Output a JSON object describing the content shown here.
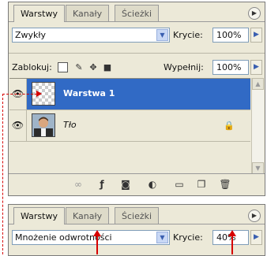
{
  "panel1": {
    "tabs": [
      "Warstwy",
      "Kanały",
      "Ścieżki"
    ],
    "blend_mode": "Zwykły",
    "opacity_label": "Krycie:",
    "opacity_value": "100%",
    "lock_label": "Zablokuj:",
    "fill_label": "Wypełnij:",
    "fill_value": "100%",
    "layers": [
      {
        "name": "Warstwa 1",
        "selected": true
      },
      {
        "name": "Tło",
        "selected": false,
        "locked": true
      }
    ]
  },
  "panel2": {
    "tabs": [
      "Warstwy",
      "Kanały",
      "Ścieżki"
    ],
    "blend_mode": "Mnożenie odwrotności",
    "opacity_label": "Krycie:",
    "opacity_value": "40%"
  },
  "colors": {
    "selection": "#316ac5",
    "annotation": "#d60000",
    "panel_bg": "#ece9d8"
  },
  "icons": {
    "lock_row": [
      "lock-transparent-icon",
      "lock-paint-icon",
      "lock-move-icon",
      "lock-all-icon"
    ],
    "bottom_bar": [
      "link-icon",
      "layer-style-icon",
      "mask-icon",
      "adjustment-icon",
      "group-icon",
      "new-layer-icon",
      "trash-icon"
    ]
  }
}
